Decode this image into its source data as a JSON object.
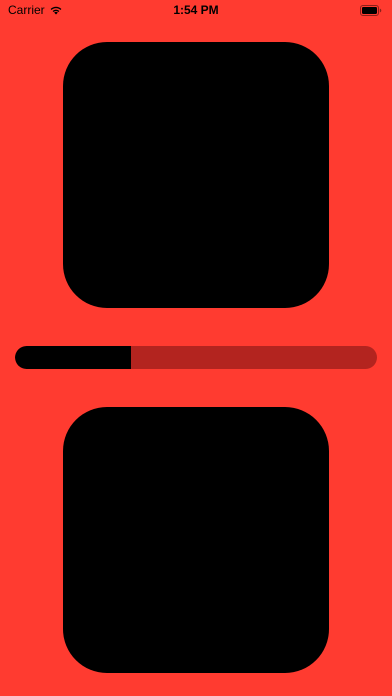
{
  "status_bar": {
    "carrier": "Carrier",
    "time": "1:54 PM",
    "wifi_icon": "wifi-icon",
    "battery_icon": "battery-icon"
  },
  "colors": {
    "background": "#FF3B30",
    "card": "#000000",
    "progress_track": "#B3241F",
    "progress_fill": "#000000"
  },
  "progress": {
    "fraction": 0.32
  }
}
